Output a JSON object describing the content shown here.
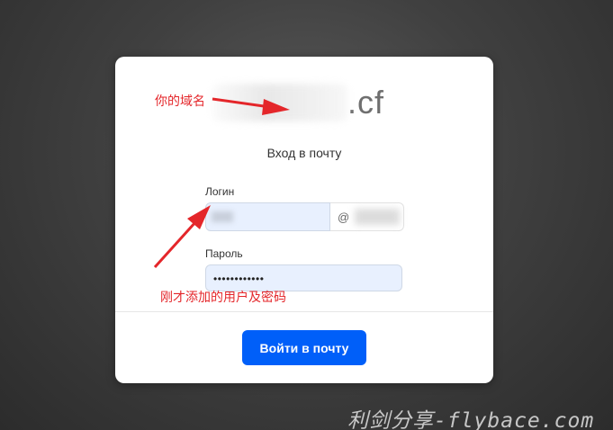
{
  "domain": {
    "suffix": ".cf"
  },
  "form": {
    "heading": "Вход в почту",
    "login_label": "Логин",
    "at_sign": "@",
    "password_label": "Пароль",
    "password_value": "••••••••••••",
    "submit_label": "Войти в почту"
  },
  "annotations": {
    "domain_note": "你的域名",
    "credentials_note": "刚才添加的用户及密码",
    "arrow_color": "#e4262a"
  },
  "watermark": "利剑分享-flybace.com"
}
